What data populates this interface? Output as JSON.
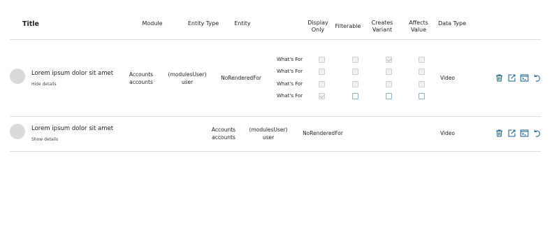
{
  "header": {
    "title": "Title",
    "module": "Module",
    "entity_type": "Entity Type",
    "entity": "Entity",
    "display_only_1": "Display",
    "display_only_2": "Only",
    "filterable": "Filterable",
    "creates_variant_1": "Creates",
    "creates_variant_2": "Variant",
    "affects_value_1": "Affects",
    "affects_value_2": "Value",
    "data_type": "Data Type"
  },
  "rows": [
    {
      "title": "Lorem ipsum dolor sit amet",
      "toggle": "Hide details",
      "module_1": "Accounts",
      "module_2": "accounts",
      "entity_type_1": "(modulesUser)",
      "entity_type_2": "user",
      "entity": "NoRenderedFor",
      "data_type": "Video",
      "options": [
        {
          "label": "What's For",
          "display_only": false,
          "filterable": false,
          "creates_variant": true,
          "affects_value": false
        },
        {
          "label": "What's For",
          "display_only": false,
          "filterable": false,
          "creates_variant": false,
          "affects_value": false
        },
        {
          "label": "What's For",
          "display_only": false,
          "filterable": false,
          "creates_variant": false,
          "affects_value": false
        },
        {
          "label": "What's For",
          "display_only": true,
          "filterable": false,
          "creates_variant": false,
          "affects_value": false
        }
      ]
    },
    {
      "title": "Lorem ipsum dolor sit amet",
      "toggle": "Show details",
      "module_1": "Accounts",
      "module_2": "accounts",
      "entity_type_1": "(modulesUser)",
      "entity_type_2": "user",
      "entity": "NoRenderedFor",
      "data_type": "Video"
    }
  ],
  "icons": [
    "trash-icon",
    "edit-external-icon",
    "terminal-icon",
    "undo-icon"
  ],
  "colors": {
    "icon": "#2b6d8f",
    "checkbox_border": "#8ab4c8",
    "divider": "#dcdcdc"
  }
}
